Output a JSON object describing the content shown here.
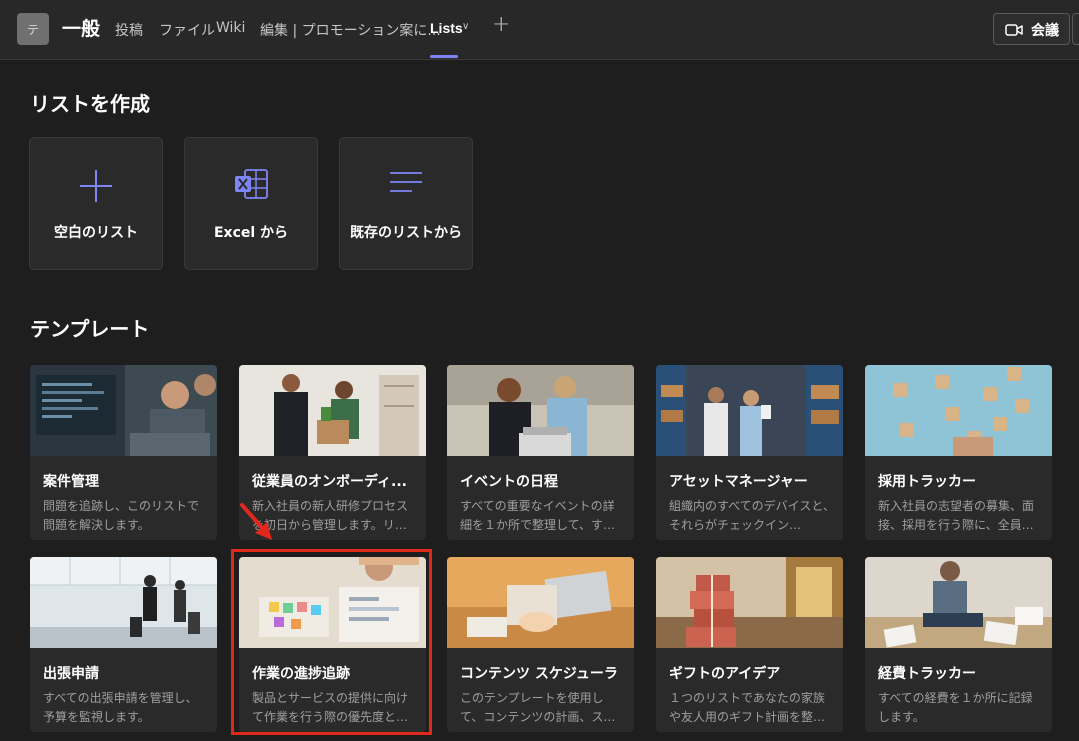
{
  "topbar": {
    "team_initial": "テ",
    "channel": "一般",
    "tabs": [
      {
        "label": "投稿"
      },
      {
        "label": "ファイル"
      },
      {
        "label": "Wiki"
      },
      {
        "label": "編集 | プロモーション案に..."
      },
      {
        "label": "Lists"
      }
    ],
    "meet_label": "会議"
  },
  "create": {
    "title": "リストを作成",
    "cards": [
      {
        "label": "空白のリスト",
        "icon": "plus-icon"
      },
      {
        "label": "Excel から",
        "icon": "excel-icon"
      },
      {
        "label": "既存のリストから",
        "icon": "list-lines-icon"
      }
    ]
  },
  "templates": {
    "title": "テンプレート",
    "cards": [
      {
        "title": "案件管理",
        "desc": "問題を追跡し、このリストで問題を解決します。"
      },
      {
        "title": "従業員のオンボーディ...",
        "desc": "新入社員の新人研修プロセスを初日から管理します。リ…"
      },
      {
        "title": "イベントの日程",
        "desc": "すべての重要なイベントの詳細を１か所で整理して、す…"
      },
      {
        "title": "アセットマネージャー",
        "desc": "組織内のすべてのデバイスと、それらがチェックイン…"
      },
      {
        "title": "採用トラッカー",
        "desc": "新入社員の志望者の募集、面接、採用を行う際に、全員…"
      },
      {
        "title": "出張申請",
        "desc": "すべての出張申請を管理し、予算を監視します。"
      },
      {
        "title": "作業の進捗追跡",
        "desc": "製品とサービスの提供に向けて作業を行う際の優先度と…"
      },
      {
        "title": "コンテンツ スケジューラ",
        "desc": "このテンプレートを使用して、コンテンツの計画、ス…"
      },
      {
        "title": "ギフトのアイデア",
        "desc": "１つのリストであなたの家族や友人用のギフト計画を整…"
      },
      {
        "title": "経費トラッカー",
        "desc": "すべての経費を１か所に記録します。"
      }
    ]
  },
  "colors": {
    "accent": "#7f85f5",
    "highlight": "#e0281c",
    "background": "#1f1e1f",
    "card": "#2b2a2b"
  }
}
